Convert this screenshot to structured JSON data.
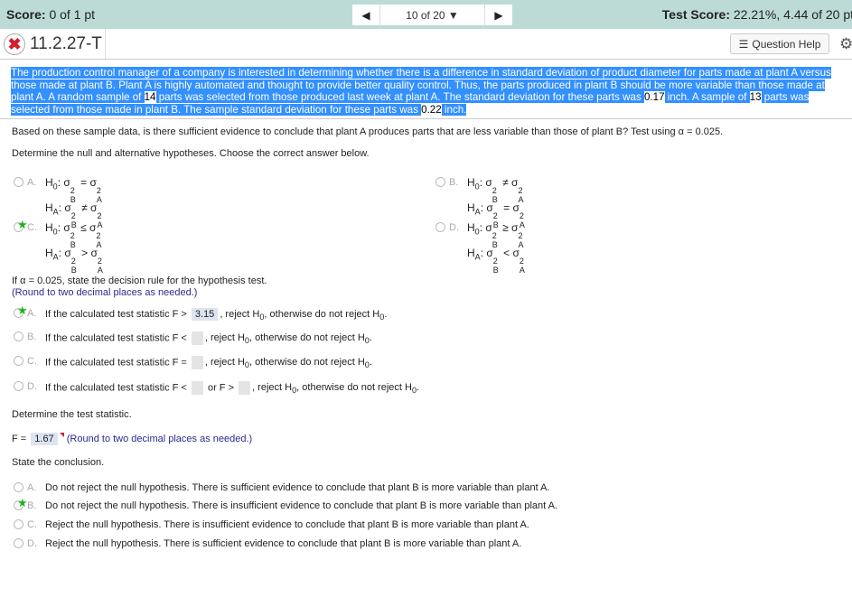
{
  "header": {
    "score_label": "Score:",
    "score_value": "0 of 1 pt",
    "nav_prev": "◀",
    "nav_position": "10 of 20",
    "nav_dropdown": "▼",
    "nav_next": "▶",
    "test_score_label": "Test Score:",
    "test_score_value": "22.21%, 4.44 of 20 pt"
  },
  "question": {
    "status_icon": "incorrect-x-icon",
    "id": "11.2.27-T",
    "help_label": "Question Help"
  },
  "prompt": {
    "part1": "The production control manager of a company is interested in determining whether there is a difference in standard deviation of product diameter for parts made at plant A versus those made at plant B. Plant A is highly automated and thought to provide better quality control. Thus, the parts produced in plant B should be more variable than those made at plant A. A random sample of ",
    "n_a": "14",
    "part2": " parts was selected from those produced last week at plant A. The standard deviation for these parts was ",
    "s_a": "0.17",
    "part3": " inch. A sample of ",
    "n_b": "13",
    "part4": " parts was selected from those made in plant B. The sample standard deviation for these parts was ",
    "s_b": "0.22",
    "part5": " inch."
  },
  "question_text": "Based on these sample data, is there sufficient evidence to conclude that plant A produces parts that are less variable than those of plant B? Test using α = 0.025.",
  "hypotheses": {
    "instruction": "Determine the null and alternative hypotheses. Choose the correct answer below.",
    "options": [
      {
        "letter": "A.",
        "h0_op": "=",
        "ha_op": "≠",
        "correct": false
      },
      {
        "letter": "B.",
        "h0_op": "≠",
        "ha_op": "=",
        "correct": false
      },
      {
        "letter": "C.",
        "h0_op": "≤",
        "ha_op": ">",
        "correct": true
      },
      {
        "letter": "D.",
        "h0_op": "≥",
        "ha_op": "<",
        "correct": false
      }
    ]
  },
  "decision_rule": {
    "instruction": "If α = 0.025, state the decision rule for the hypothesis test.",
    "round_note": "(Round to two decimal places as needed.)",
    "options": [
      {
        "letter": "A.",
        "prefix": "If the calculated test statistic F >",
        "value": "3.15",
        "suffix": ", reject H0, otherwise do not reject H0.",
        "correct": true
      },
      {
        "letter": "B.",
        "prefix": "If the calculated test statistic F <",
        "value": "",
        "suffix": ", reject H0, otherwise do not reject H0."
      },
      {
        "letter": "C.",
        "prefix": "If the calculated test statistic F =",
        "value": "",
        "suffix": ", reject H0, otherwise do not reject H0."
      },
      {
        "letter": "D.",
        "prefix": "If the calculated test statistic F <",
        "middle": "or F >",
        "value": "",
        "suffix": ", reject H0, otherwise do not reject H0."
      }
    ]
  },
  "test_statistic": {
    "instruction": "Determine the test statistic.",
    "label": "F =",
    "value": "1.67",
    "round_note": "(Round to two decimal places as needed.)"
  },
  "conclusion": {
    "instruction": "State the conclusion.",
    "options": [
      {
        "letter": "A.",
        "text": "Do not reject the null hypothesis. There is sufficient evidence to conclude that plant B is more variable than plant A."
      },
      {
        "letter": "B.",
        "text": "Do not reject the null hypothesis. There is insufficient evidence to conclude that plant B is more variable than plant A.",
        "correct": true
      },
      {
        "letter": "C.",
        "text": "Reject the null hypothesis. There is insufficient evidence to conclude that plant B is more variable than plant A."
      },
      {
        "letter": "D.",
        "text": "Reject the null hypothesis. There is sufficient evidence to conclude that plant B is more variable than plant A."
      }
    ]
  },
  "colors": {
    "topbar": "#bcdbd6",
    "highlight": "#3390ff",
    "correct_star": "#1db31d",
    "incorrect": "#d21f2b",
    "note_blue": "#2a2a8f"
  }
}
